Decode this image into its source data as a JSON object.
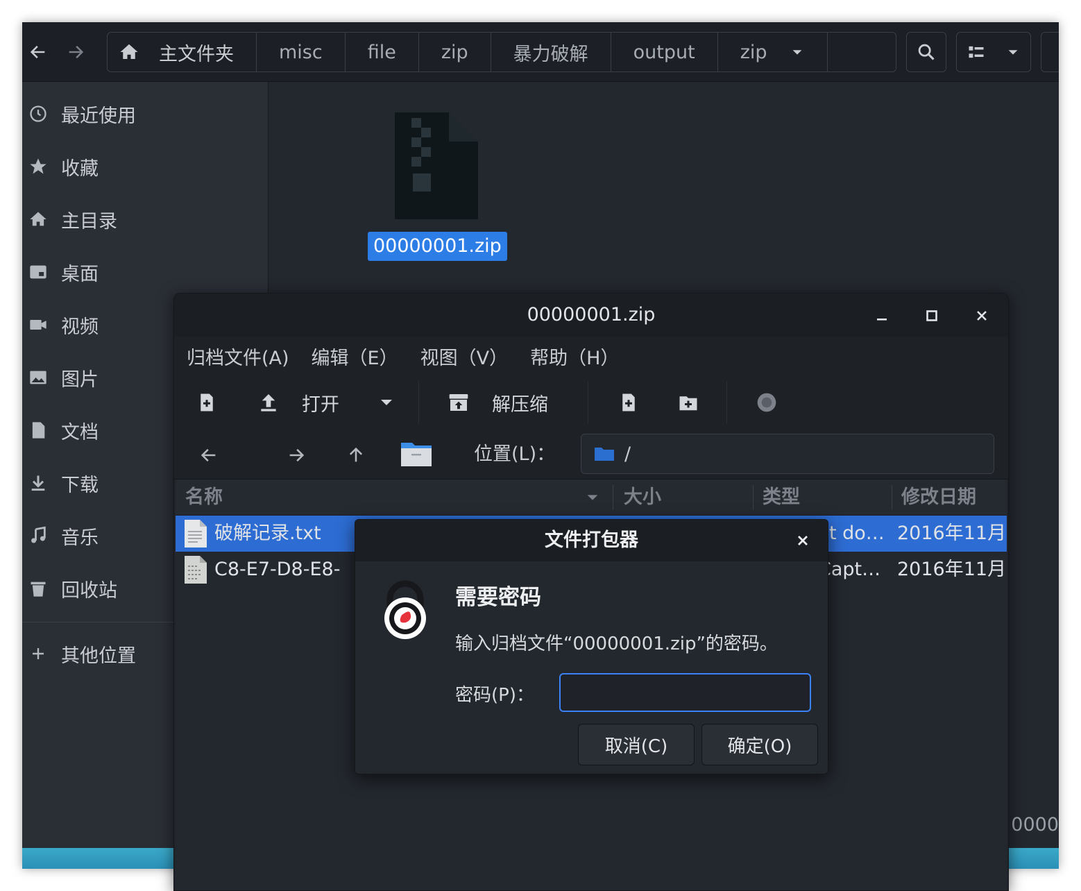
{
  "file_manager": {
    "breadcrumb": [
      "主文件夹",
      "misc",
      "file",
      "zip",
      "暴力破解",
      "output",
      "zip"
    ],
    "sidebar": [
      {
        "label": "最近使用",
        "icon": "clock-icon"
      },
      {
        "label": "收藏",
        "icon": "star-icon"
      },
      {
        "label": "主目录",
        "icon": "home-icon"
      },
      {
        "label": "桌面",
        "icon": "desktop-icon"
      },
      {
        "label": "视频",
        "icon": "video-icon"
      },
      {
        "label": "图片",
        "icon": "image-icon"
      },
      {
        "label": "文档",
        "icon": "document-icon"
      },
      {
        "label": "下载",
        "icon": "download-icon"
      },
      {
        "label": "音乐",
        "icon": "music-icon"
      },
      {
        "label": "回收站",
        "icon": "trash-icon"
      }
    ],
    "other_locations": "其他位置",
    "file_name": "00000001.zip",
    "bottom_fragment": "0000"
  },
  "archive_manager": {
    "title": "00000001.zip",
    "menus": [
      "归档文件(A)",
      "编辑（E）",
      "视图（V）",
      "帮助（H）"
    ],
    "toolbar": {
      "open_label": "打开",
      "extract_label": "解压缩"
    },
    "location_label": "位置(L)：",
    "location_value": "/",
    "columns": {
      "name": "名称",
      "size": "大小",
      "type": "类型",
      "modified": "修改日期"
    },
    "rows": [
      {
        "name": "破解记录.txt",
        "type": "xt do…",
        "modified": "2016年11月"
      },
      {
        "name": "C8-E7-D8-E8-",
        "type": "Capt…",
        "modified": "2016年11月"
      }
    ]
  },
  "dialog": {
    "title": "文件打包器",
    "heading": "需要密码",
    "message": "输入归档文件“00000001.zip”的密码。",
    "password_label": "密码(P)：",
    "password_value": "",
    "cancel_label": "取消(C)",
    "ok_label": "确定(O)"
  },
  "colors": {
    "accent": "#2d7de6",
    "selection": "#2d6cd2",
    "input_focus": "#3b82f6",
    "window_bg": "#23272e",
    "dialog_icon_red": "#e5323b"
  }
}
